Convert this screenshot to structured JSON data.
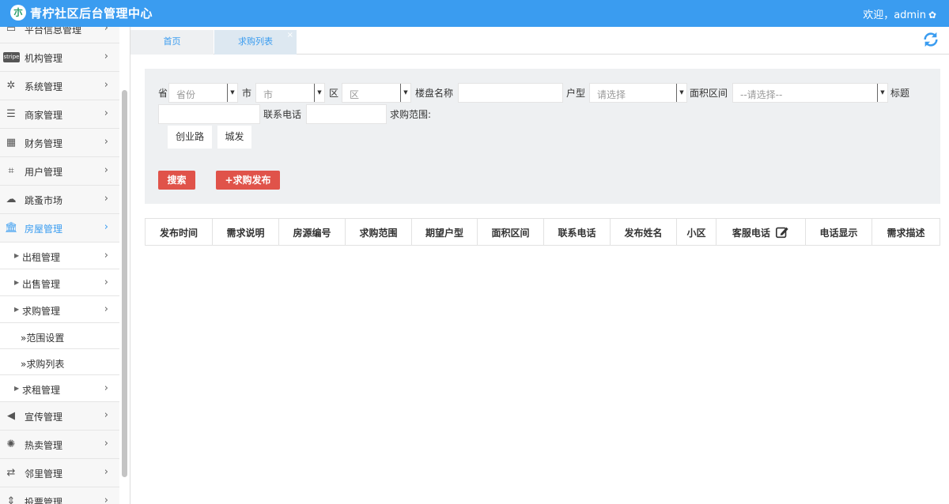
{
  "header": {
    "title": "青柠社区后台管理中心",
    "welcome": "欢迎，admin",
    "logo_char": "朩"
  },
  "sidebar": {
    "items": [
      {
        "label": "平台信息管理",
        "icon": "monitor-icon"
      },
      {
        "label": "机构管理",
        "icon": "stripe-icon",
        "icon_text": "stripe"
      },
      {
        "label": "系统管理",
        "icon": "yelp-icon"
      },
      {
        "label": "商家管理",
        "icon": "list-icon"
      },
      {
        "label": "财务管理",
        "icon": "calculator-icon"
      },
      {
        "label": "用户管理",
        "icon": "crop-icon"
      },
      {
        "label": "跳蚤市场",
        "icon": "cloud-icon"
      },
      {
        "label": "房屋管理",
        "icon": "bank-icon",
        "active": true
      }
    ],
    "house_subs": [
      {
        "label": "出租管理"
      },
      {
        "label": "出售管理"
      },
      {
        "label": "求购管理"
      }
    ],
    "purchase_leaves": [
      {
        "label": "范围设置"
      },
      {
        "label": "求购列表"
      }
    ],
    "after_subs": [
      {
        "label": "求租管理"
      }
    ],
    "bottom_items": [
      {
        "label": "宣传管理",
        "icon": "volume-icon"
      },
      {
        "label": "热卖管理",
        "icon": "sun-icon"
      },
      {
        "label": "邻里管理",
        "icon": "retweet-icon"
      },
      {
        "label": "投票管理",
        "icon": "sort-icon"
      }
    ]
  },
  "tabs": {
    "home": "首页",
    "current": "求购列表"
  },
  "filters": {
    "province_label": "省",
    "province_placeholder": "省份",
    "city_label": "市",
    "city_placeholder": "市",
    "district_label": "区",
    "district_placeholder": "区",
    "building_label": "楼盘名称",
    "layout_label": "户型",
    "layout_placeholder": "请选择",
    "area_label": "面积区间",
    "area_placeholder": "--请选择--",
    "title_label": "标题",
    "phone_label": "联系电话",
    "range_label": "求购范围:",
    "range_chips": [
      "创业路",
      "城发"
    ],
    "search_button": "搜索",
    "publish_button": "+求购发布"
  },
  "table": {
    "headers": [
      "发布时间",
      "需求说明",
      "房源编号",
      "求购范围",
      "期望户型",
      "面积区间",
      "联系电话",
      "发布姓名",
      "小区",
      "客服电话",
      "电话显示",
      "需求描述"
    ]
  }
}
